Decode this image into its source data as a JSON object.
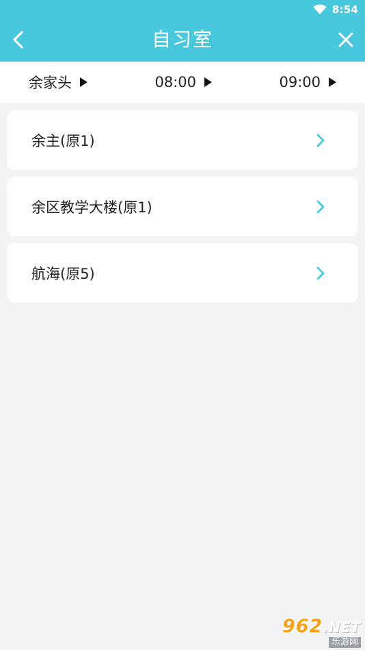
{
  "status_bar": {
    "time": "8:54"
  },
  "header": {
    "title": "自习室",
    "back_icon": "chevron-left-icon",
    "close_icon": "close-icon"
  },
  "filters": [
    {
      "label": "余家头"
    },
    {
      "label": "08:00"
    },
    {
      "label": "09:00"
    }
  ],
  "rooms": [
    {
      "label": "余主(原1)"
    },
    {
      "label": "余区教学大楼(原1)"
    },
    {
      "label": "航海(原5)"
    }
  ],
  "watermark": {
    "top": "962",
    "net": ".NET",
    "bottom": "乐游网"
  },
  "colors": {
    "accent": "#47c8dc",
    "background": "#f2f3f5",
    "card": "#ffffff",
    "chevron": "#47c8dc"
  }
}
